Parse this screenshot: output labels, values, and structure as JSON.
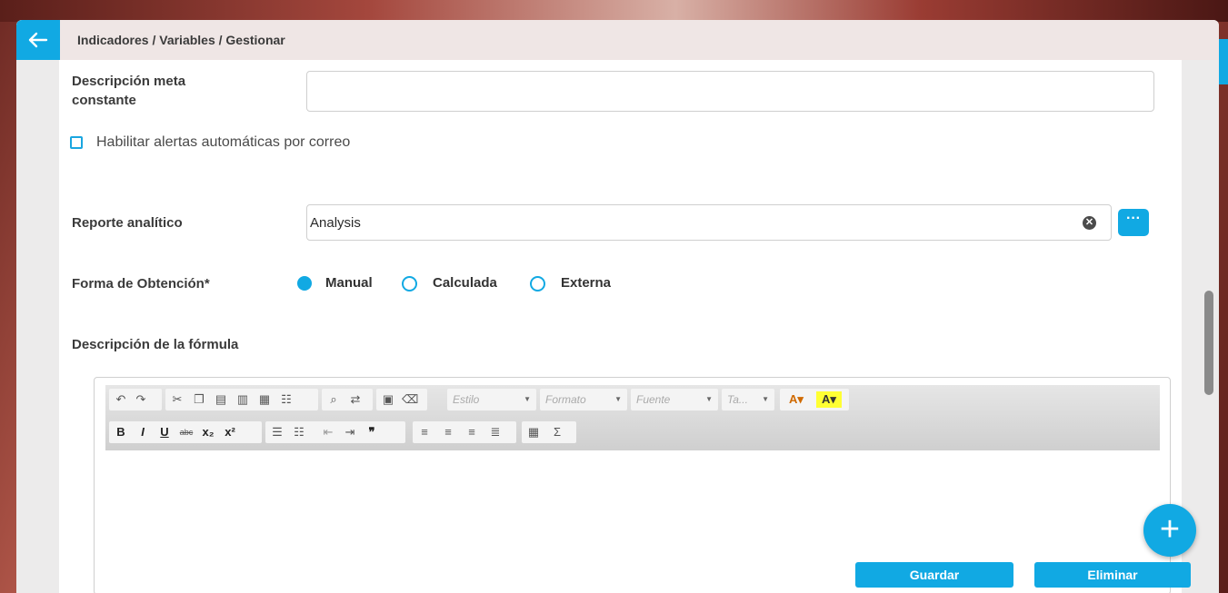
{
  "header": {
    "breadcrumb": "Indicadores / Variables / Gestionar"
  },
  "form": {
    "meta_desc_label": "Descripción meta constante",
    "meta_desc_value": "",
    "alerts_checkbox_label": "Habilitar alertas automáticas por correo",
    "alerts_checked": false,
    "report_label": "Reporte analítico",
    "report_value": "Analysis",
    "report_more_label": "···",
    "obtain_label": "Forma de Obtención*",
    "obtain_options": [
      "Manual",
      "Calculada",
      "Externa"
    ],
    "obtain_selected": "Manual",
    "formula_label": "Descripción de la fórmula"
  },
  "editor": {
    "combos": [
      "Estilo",
      "Formato",
      "Fuente",
      "Ta..."
    ],
    "body_text": ""
  },
  "actions": {
    "save": "Guardar",
    "delete": "Eliminar",
    "fab": "+"
  },
  "colors": {
    "accent": "#11a9e3"
  }
}
